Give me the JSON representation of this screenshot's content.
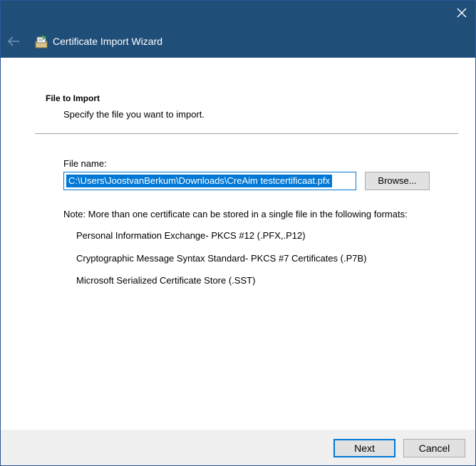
{
  "window": {
    "title": "Certificate Import Wizard",
    "accent_color": "#1f4e79",
    "icons": {
      "close": "close-icon",
      "back": "back-arrow-icon",
      "wizard": "certificate-wizard-icon"
    }
  },
  "page": {
    "section_title": "File to Import",
    "section_subtitle": "Specify the file you want to import."
  },
  "file": {
    "label": "File name:",
    "value": "C:\\Users\\JoostvanBerkum\\Downloads\\CreAim testcertificaat.pfx",
    "browse_label": "Browse..."
  },
  "note": {
    "text": "Note:  More than one certificate can be stored in a single file in the following formats:",
    "formats": [
      "Personal Information Exchange- PKCS #12 (.PFX,.P12)",
      "Cryptographic Message Syntax Standard- PKCS #7 Certificates (.P7B)",
      "Microsoft Serialized Certificate Store (.SST)"
    ]
  },
  "footer": {
    "next_label": "Next",
    "cancel_label": "Cancel"
  }
}
